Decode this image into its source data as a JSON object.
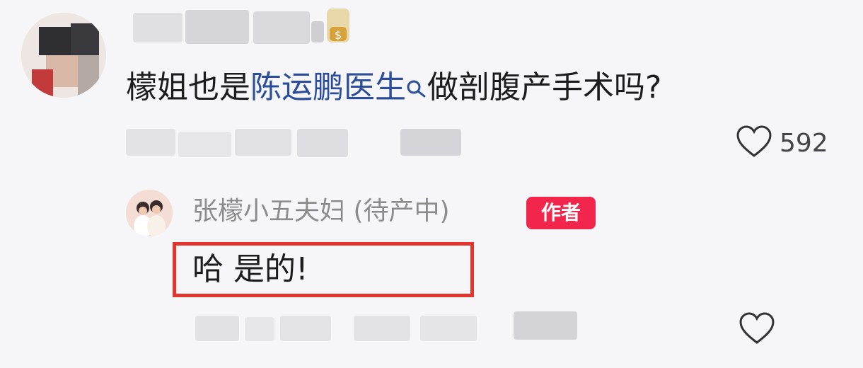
{
  "comment": {
    "text_before_link": "檬姐也是",
    "link_text": "陈运鹏医生",
    "text_after_link": "做剖腹产手术吗?",
    "like_count": "592"
  },
  "reply": {
    "username": "张檬小五夫妇 (待产中)",
    "badge": "作者",
    "text": "哈 是的!"
  },
  "icons": [
    "search-mini-icon",
    "heart-icon",
    "coin-badge-icon"
  ],
  "colors": {
    "link": "#2b4d9b",
    "badge": "#f2264d",
    "highlight_box": "#e0362e"
  }
}
